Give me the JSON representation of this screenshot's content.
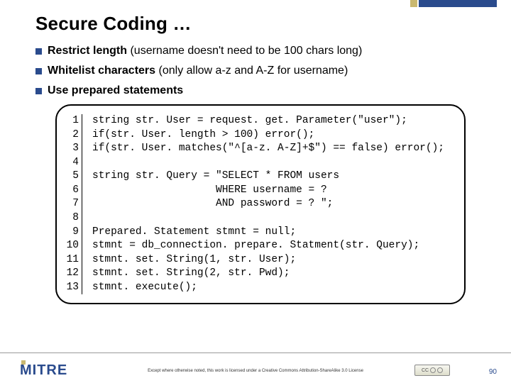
{
  "title": "Secure Coding …",
  "bullets": [
    {
      "bold": "Restrict length",
      "rest": "  (username doesn't need to be 100 chars long)"
    },
    {
      "bold": "Whitelist characters",
      "rest": "  (only allow a-z and A-Z for username)"
    },
    {
      "bold": "Use prepared statements",
      "rest": ""
    }
  ],
  "code": {
    "linenos": "1\n2\n3\n4\n5\n6\n7\n8\n9\n10\n11\n12\n13",
    "body": "string str. User = request. get. Parameter(\"user\");\nif(str. User. length > 100) error();\nif(str. User. matches(\"^[a-z. A-Z]+$\") == false) error();\n\nstring str. Query = \"SELECT * FROM users\n                    WHERE username = ?\n                    AND password = ? \";\n\nPrepared. Statement stmnt = null;\nstmnt = db_connection. prepare. Statment(str. Query);\nstmnt. set. String(1, str. User);\nstmnt. set. String(2, str. Pwd);\nstmnt. execute();"
  },
  "footer": {
    "logo_text": "MITRE",
    "license_text": "Except where otherwise noted, this work is licensed under a Creative Commons Attribution-ShareAlike 3.0 License",
    "cc_label": "CC",
    "page_number": "90"
  }
}
